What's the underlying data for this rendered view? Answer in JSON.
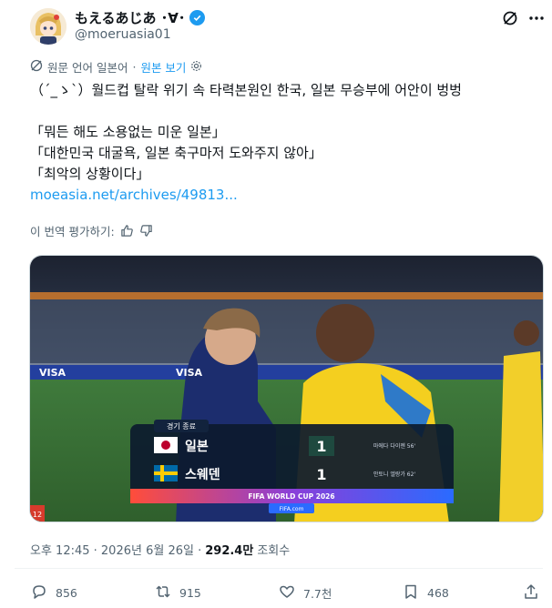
{
  "author": {
    "display_name": "もえるあじあ ･∀･",
    "handle": "@moeruasia01"
  },
  "translation": {
    "source_label": "원문 언어 일본어",
    "view_original": "원본 보기"
  },
  "tweet": {
    "lines": [
      "（´_ゝ`）월드컵 탈락 위기 속 타력본원인 한국, 일본 무승부에 어안이 벙벙",
      "",
      "「뭐든 해도 소용없는 미운 일본」",
      "「대한민국 대굴욕, 일본 축구마저 도와주지 않아」",
      "「최악의 상황이다」"
    ],
    "link": "moeasia.net/archives/49813..."
  },
  "rate_translation": "이 번역 평가하기:",
  "media": {
    "scoreboard": {
      "header": "경기 종료",
      "team1": "일본",
      "team2": "스웨덴",
      "score1": "1",
      "score2": "1",
      "scorer1": "마에다 다이젠 56'",
      "scorer2": "안토니 엘랑가 62'",
      "footer_title": "FIFA WORLD CUP 2026",
      "footer_site": "FIFA.com"
    },
    "ad_boards": [
      "VISA",
      "VISA"
    ],
    "corner_badge": "12"
  },
  "meta": {
    "time": "오후 12:45 · 2026년 6월 26일 ·",
    "views": "292.4만",
    "views_label": "조회수"
  },
  "actions": {
    "replies": "856",
    "reposts": "915",
    "likes": "7.7천",
    "bookmarks": "468"
  },
  "colors": {
    "accent": "#1d9bf0",
    "text": "#0f1419",
    "muted": "#536471"
  }
}
